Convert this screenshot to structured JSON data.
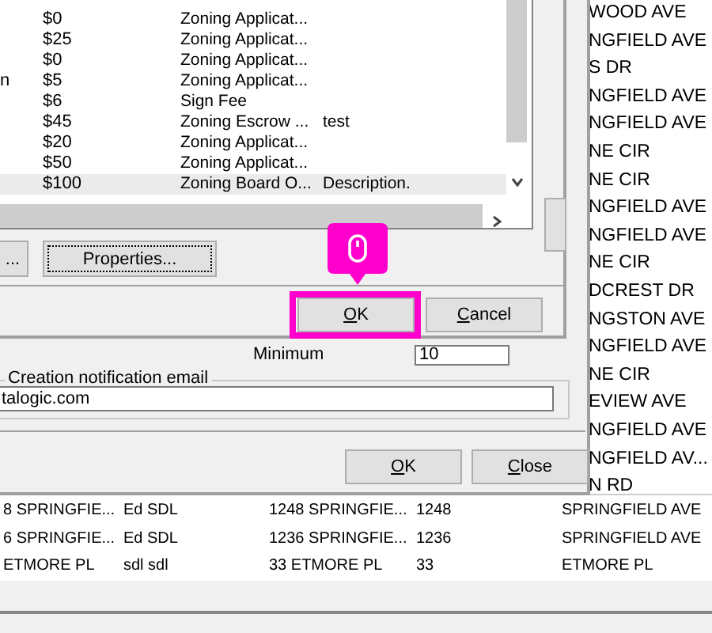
{
  "street_list": {
    "items": [
      "WOOD AVE",
      "NGFIELD AVE",
      "S DR",
      "NGFIELD AVE",
      "NGFIELD AVE",
      "NE CIR",
      "NE CIR",
      "NGFIELD AVE",
      "NGFIELD AVE",
      "NE CIR",
      "DCREST DR",
      "NGSTON AVE",
      "NGFIELD AVE",
      "NE CIR",
      "EVIEW AVE",
      "NGFIELD AVE",
      "NGFIELD AV...",
      "N RD"
    ]
  },
  "address_table": {
    "rows": [
      {
        "cells": [
          "8 SPRINGFIE...",
          "Ed SDL",
          "1248 SPRINGFIE...",
          "1248",
          "SPRINGFIELD AVE"
        ]
      },
      {
        "cells": [
          "6 SPRINGFIE...",
          "Ed SDL",
          "1236 SPRINGFIE...",
          "1236",
          "SPRINGFIELD AVE"
        ]
      },
      {
        "cells": [
          "ETMORE PL",
          "sdl sdl",
          "33 ETMORE PL",
          "33",
          "ETMORE PL"
        ]
      }
    ]
  },
  "settings_dialog": {
    "minimum_label": "Minimum",
    "minimum_value": "10",
    "email_group": "Creation notification email",
    "email_value": "talogic.com",
    "buttons": [
      "OK",
      "Close"
    ]
  },
  "fee_dialog": {
    "rows": [
      {
        "amount": "$0",
        "description": "Zoning Applicat...",
        "selected": false
      },
      {
        "amount": "$25",
        "description": "Zoning Applicat...",
        "selected": false
      },
      {
        "amount": "$0",
        "description": "Zoning Applicat...",
        "selected": false
      },
      {
        "column_1": "n",
        "amount": "$5",
        "description": "Zoning Applicat...",
        "selected": false
      },
      {
        "amount": "$6",
        "description": "Sign Fee",
        "selected": false
      },
      {
        "amount": "$45",
        "description": "Zoning Escrow ...",
        "column_4": "test",
        "selected": false
      },
      {
        "amount": "$20",
        "description": "Zoning Applicat...",
        "selected": false
      },
      {
        "amount": "$50",
        "description": "Zoning Applicat...",
        "selected": false
      },
      {
        "amount": "$100",
        "description": "Zoning Board O...",
        "column_4": "Description.",
        "selected": true
      }
    ],
    "list_buttons": [
      "...",
      "Properties..."
    ],
    "buttons": [
      "OK",
      "Cancel"
    ]
  }
}
